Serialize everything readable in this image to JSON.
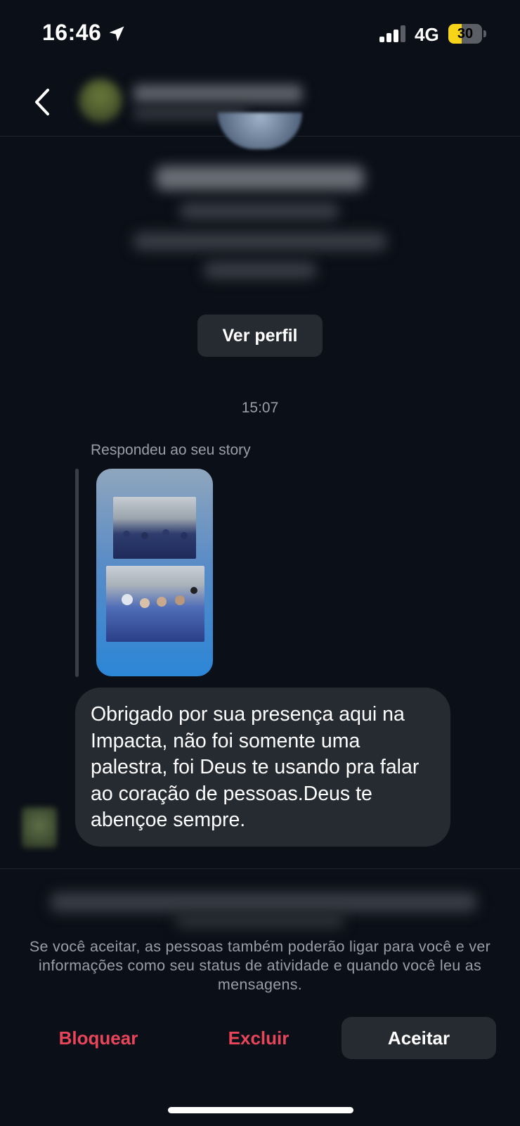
{
  "status_bar": {
    "time": "16:46",
    "network": "4G",
    "battery": "30",
    "location_icon": "location-arrow-icon",
    "signal_icon": "cellular-signal-icon"
  },
  "header": {
    "back_icon": "chevron-left-icon"
  },
  "profile": {
    "view_profile_label": "Ver perfil"
  },
  "conversation": {
    "timestamp": "15:07",
    "reply_label": "Respondeu ao seu story",
    "message": "Obrigado por sua presença aqui na Impacta, não foi somente uma palestra, foi Deus te usando pra falar ao coração de pessoas.Deus te abençoe sempre."
  },
  "request": {
    "info": "Se você aceitar, as pessoas também poderão ligar para você e ver informações como seu status de atividade e quando você leu as mensagens.",
    "block_label": "Bloquear",
    "delete_label": "Excluir",
    "accept_label": "Aceitar"
  },
  "colors": {
    "background": "#0b0f17",
    "bubble": "#262a31",
    "danger": "#e8455a",
    "muted_text": "#9a9ea6"
  }
}
